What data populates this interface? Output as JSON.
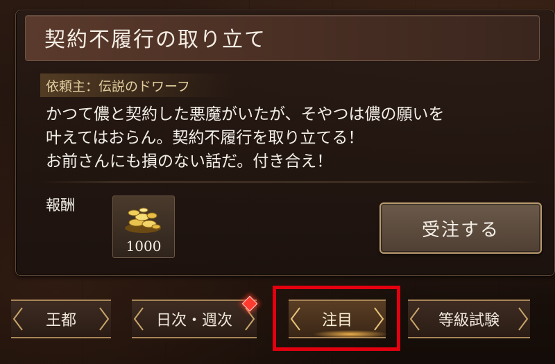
{
  "quest": {
    "title": "契約不履行の取り立て",
    "client": "依頼主：伝説のドワーフ",
    "description": "かつて儂と契約した悪魔がいたが、そやつは儂の願いを\n叶えてはおらん。契約不履行を取り立てる！\nお前さんにも損のない話だ。付き合え！"
  },
  "reward": {
    "label": "報酬",
    "item_icon": "gold-coins-icon",
    "amount": "1000"
  },
  "actions": {
    "accept_label": "受注する"
  },
  "tabs": [
    {
      "label": "王都",
      "active": false,
      "notification": false
    },
    {
      "label": "日次・週次",
      "active": false,
      "notification": true
    },
    {
      "label": "注目",
      "active": true,
      "notification": false
    },
    {
      "label": "等級試験",
      "active": false,
      "notification": false
    }
  ],
  "colors": {
    "highlight": "#e4000f",
    "text_gold": "#e2cf9e",
    "tab_border": "#a88658"
  }
}
